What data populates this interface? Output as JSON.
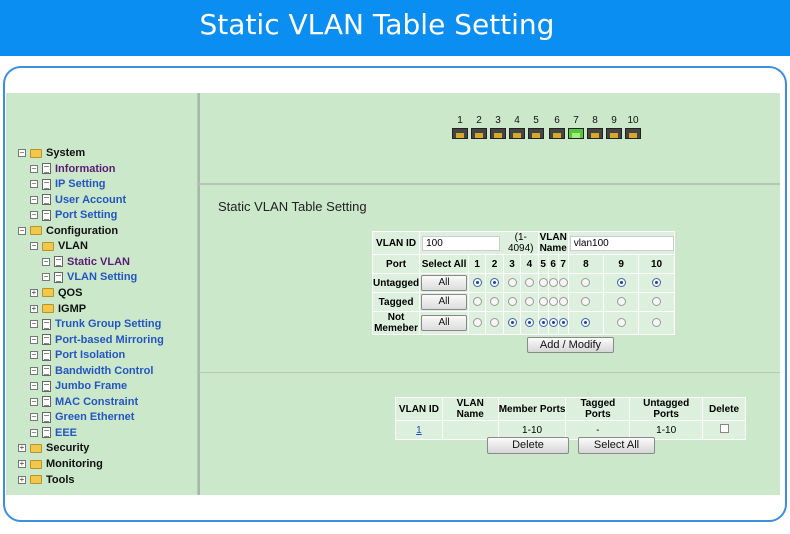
{
  "banner": {
    "title": "Static VLAN Table Setting"
  },
  "tree": [
    {
      "label": "System",
      "kind": "folder",
      "expander": "⊟",
      "color": "black"
    },
    {
      "label": "Information",
      "kind": "doc",
      "expander": "⊟",
      "color": "purple"
    },
    {
      "label": "IP Setting",
      "kind": "doc",
      "expander": "⊟",
      "color": "blue"
    },
    {
      "label": "User Account",
      "kind": "doc",
      "expander": "⊟",
      "color": "blue"
    },
    {
      "label": "Port Setting",
      "kind": "doc",
      "expander": "⊟",
      "color": "blue"
    },
    {
      "label": "Configuration",
      "kind": "folder",
      "expander": "⊟",
      "color": "black"
    },
    {
      "label": "VLAN",
      "kind": "folder",
      "expander": "⊟",
      "color": "black"
    },
    {
      "label": "Static VLAN",
      "kind": "doc",
      "expander": "⊟",
      "color": "purple"
    },
    {
      "label": "VLAN Setting",
      "kind": "doc",
      "expander": "⊟",
      "color": "blue"
    },
    {
      "label": "QOS",
      "kind": "folder",
      "expander": "⊞",
      "color": "black"
    },
    {
      "label": "IGMP",
      "kind": "folder",
      "expander": "⊞",
      "color": "black"
    },
    {
      "label": "Trunk Group Setting",
      "kind": "doc",
      "expander": "⊟",
      "color": "blue"
    },
    {
      "label": "Port-based Mirroring",
      "kind": "doc",
      "expander": "⊟",
      "color": "blue"
    },
    {
      "label": "Port Isolation",
      "kind": "doc",
      "expander": "⊟",
      "color": "blue"
    },
    {
      "label": "Bandwidth Control",
      "kind": "doc",
      "expander": "⊟",
      "color": "blue"
    },
    {
      "label": "Jumbo Frame",
      "kind": "doc",
      "expander": "⊟",
      "color": "blue"
    },
    {
      "label": "MAC Constraint",
      "kind": "doc",
      "expander": "⊟",
      "color": "blue"
    },
    {
      "label": "Green Ethernet",
      "kind": "doc",
      "expander": "⊟",
      "color": "blue"
    },
    {
      "label": "EEE",
      "kind": "doc",
      "expander": "⊟",
      "color": "blue"
    },
    {
      "label": "Security",
      "kind": "folder",
      "expander": "⊞",
      "color": "black"
    },
    {
      "label": "Monitoring",
      "kind": "folder",
      "expander": "⊞",
      "color": "black"
    },
    {
      "label": "Tools",
      "kind": "folder",
      "expander": "⊞",
      "color": "black"
    }
  ],
  "ports": {
    "numbers": [
      "1",
      "2",
      "3",
      "4",
      "5",
      "6",
      "7",
      "8",
      "9",
      "10"
    ],
    "link_up": [
      false,
      false,
      false,
      false,
      false,
      false,
      true,
      false,
      false,
      false
    ]
  },
  "section": {
    "title": "Static VLAN Table Setting"
  },
  "form": {
    "vlan_id_label": "VLAN ID",
    "vlan_id_value": "100",
    "vlan_id_range": "(1-4094)",
    "vlan_name_label": "VLAN Name",
    "vlan_name_value": "vlan100",
    "port_header": "Port",
    "select_all_header": "Select All",
    "all_button": "All",
    "rows": [
      {
        "label": "Untagged",
        "selected": [
          true,
          true,
          false,
          false,
          false,
          false,
          false,
          false,
          true,
          true
        ]
      },
      {
        "label": "Tagged",
        "selected": [
          false,
          false,
          false,
          false,
          false,
          false,
          false,
          false,
          false,
          false
        ]
      },
      {
        "label": "Not Memeber",
        "selected": [
          false,
          false,
          true,
          true,
          true,
          true,
          true,
          true,
          false,
          false
        ]
      }
    ],
    "add_modify_button": "Add / Modify"
  },
  "vlan_table": {
    "headers": [
      "VLAN ID",
      "VLAN Name",
      "Member Ports",
      "Tagged Ports",
      "Untagged Ports",
      "Delete"
    ],
    "rows": [
      {
        "vlan_id": "1",
        "vlan_name": "",
        "member_ports": "1-10",
        "tagged_ports": "-",
        "untagged_ports": "1-10",
        "delete_checked": false
      }
    ],
    "delete_button": "Delete",
    "select_all_button": "Select All"
  },
  "colors": {
    "banner": "#0a8ef2",
    "panel": "#cbe8cb",
    "cell": "#ddf0dd",
    "frame": "#3c8fdf"
  }
}
